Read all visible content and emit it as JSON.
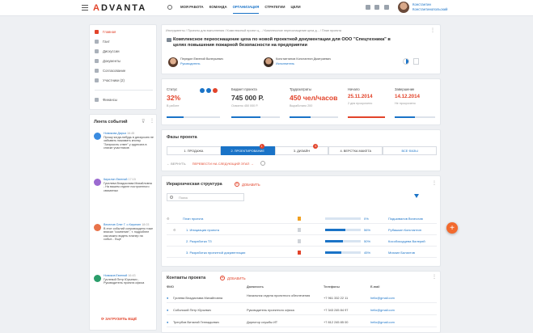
{
  "header": {
    "logo_prefix": "A",
    "logo_rest": "DVANTA",
    "nav": [
      "МОЯ РАБОТА",
      "КОМАНДА",
      "ОРГАНИЗАЦИЯ",
      "СТРАТЕГИИ",
      "ЦЕЛИ"
    ],
    "active_nav": 2,
    "user_line1": "Константин",
    "user_line2": "Константинопольский"
  },
  "menu": {
    "items": [
      "Главная",
      "Гант",
      "Дискуссии",
      "Документы",
      "Согласование",
      "Участники (2)",
      "Финансы"
    ],
    "active": 0
  },
  "feed": {
    "title": "Лента событий",
    "entries": [
      {
        "who": "Новикова Дарья",
        "when": "16:45",
        "text": "Прошу когда-нибудь в дискуссию не забывать нажимать кнопку \"Запросить ответ\" у адресата в списке участников",
        "color": "#3a8be0"
      },
      {
        "who": "Кирилин Евгений",
        "when": "17:15",
        "text": "Гуселева Владислава Михайловна - На вашем отделе построенного связанных",
        "color": "#9b6ad0"
      },
      {
        "who": "Веселов Олег Г. о Кирилин",
        "when": "18:03",
        "text": "В этот событий сопровождено тоже вписал \"сомнение\", т. подробнее как можно видеть планер на событ... Ещё",
        "color": "#e8734a"
      },
      {
        "who": "Новиков Евгений",
        "when": "16:43",
        "text": "Гуслевой Петр Юрьевич - Руководитель проекта офиса",
        "color": "#2a9d6a"
      }
    ],
    "load_more": "ЗАГРУЗИТЬ ЕЩЁ"
  },
  "task": {
    "breadcrumb": "Инструменты  /  Проекты для выполнения  /  Комплексный проект ц...  /  Комплексное переоснащение цеха д...  /  План проекта",
    "title": "Комплексное переоснащение цеха по новой проектной документации для ООО \"Спецтехника\" в целях повышения пожарной безопасности на предприятии",
    "people": [
      {
        "name": "Передин Евгений Валерьевич",
        "role": "Руководитель"
      },
      {
        "name": "Константинов Константин Дмитриевич",
        "role": "Исполнитель"
      }
    ]
  },
  "stats": {
    "status": {
      "label": "Статус",
      "value": "32%",
      "sub": "В работе",
      "progress": 0.32
    },
    "budget": {
      "label": "Бюджет проекта",
      "value": "745 000 Р.",
      "sub": "Освоено 450 000 Р.",
      "progress": 0.6
    },
    "labor": {
      "label": "Трудозатраты",
      "value": "450 чел/часов",
      "sub": "Выработано 200",
      "progress": 0.44
    },
    "start": {
      "label": "Начало",
      "value": "25.11.2014",
      "sub": "2 дня просрочено",
      "progress": 1.0
    },
    "end": {
      "label": "Завершение",
      "value": "14.12.2014",
      "sub": "Не просрочено",
      "progress": 0.5
    }
  },
  "phases": {
    "title": "Фазы проекта",
    "steps": [
      "1. ПРОДАЖА",
      "2. ПРОЕКТИРОВАНИЕ",
      "3. ДИЗАЙН",
      "4. ВЕРСТКА МАКЕТА",
      "ВСЕ ФАЗЫ"
    ],
    "active": 1,
    "badges": {
      "1": "1",
      "2": "6"
    },
    "back": "ВЕРНУТЬ",
    "next": "ПЕРЕВЕСТИ НА СЛЕДУЮЩИЙ ЭТАП"
  },
  "hierarchy": {
    "title": "Иерархическая структура",
    "add": "ДОБАВИТЬ",
    "search_placeholder": "Поиск",
    "rows": [
      {
        "name": "План проекта",
        "progress": 0.0,
        "pct": "0%",
        "owner": "Подшивалов Вячеслав",
        "flag": "#f0a020"
      },
      {
        "name": "1. Инициация проекта",
        "progress": 0.56,
        "pct": "56%",
        "owner": "Рубашкин Константин",
        "flag": "#cfd3d8"
      },
      {
        "name": "2. Разработка ТЗ",
        "progress": 0.5,
        "pct": "50%",
        "owner": "Кособокодцева Валерий",
        "flag": "#cfd3d8"
      },
      {
        "name": "3. Разработка проектной документации",
        "progress": 0.45,
        "pct": "45%",
        "owner": "Михаил Балахтов",
        "flag": "#e2432a"
      }
    ]
  },
  "contacts": {
    "title": "Контакты проекта",
    "add": "ДОБАВИТЬ",
    "columns": [
      "ФИО",
      "Должность",
      "Телефоны",
      "E-mail"
    ],
    "rows": [
      {
        "name": "Гуслева Владислава Михайловна",
        "pos": "Начальник отдела проектного обеспечения",
        "phone": "+7 961 332 22 11",
        "email": "hello@gmail.com"
      },
      {
        "name": "Соболский Петр Юрьевич",
        "pos": "Руководитель проектного офиса",
        "phone": "+7 343 245 84 97",
        "email": "hello@gmail.com"
      },
      {
        "name": "Трегубов Виталий Геннадьевич",
        "pos": "Директор службы ИТ",
        "phone": "+7 812 245 85 00",
        "email": "hello@gmail.com"
      }
    ]
  }
}
